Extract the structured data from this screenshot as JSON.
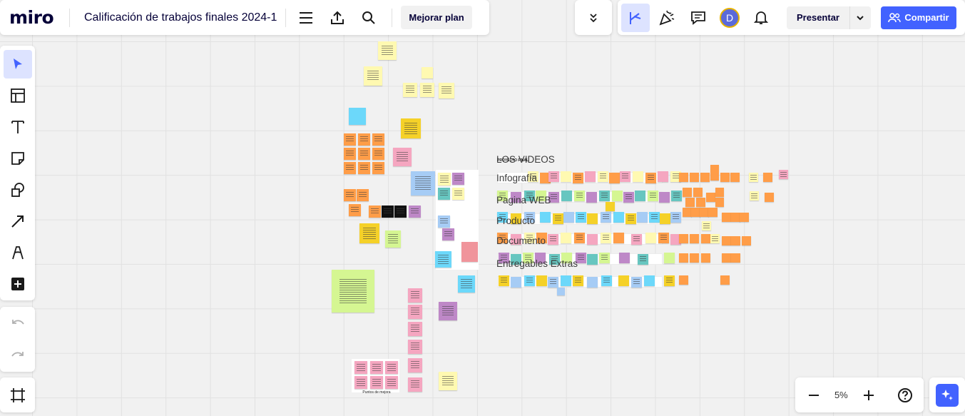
{
  "app": {
    "logo": "miro",
    "board_title": "Calificación de trabajos finales 2024-1"
  },
  "topbar": {
    "menu_icon": "menu-icon",
    "export_icon": "upload-icon",
    "search_icon": "search-icon",
    "upgrade_label": "Mejorar plan",
    "collapse_icon": "chevron-double-down-icon",
    "reactions_icon": "reactions-icon",
    "celebrate_icon": "party-popper-icon",
    "comments_icon": "comment-icon",
    "avatar_initial": "D",
    "notifications_icon": "bell-icon",
    "present_label": "Presentar",
    "share_label": "Compartir"
  },
  "toolbar": {
    "tools": [
      "select-tool",
      "templates-tool",
      "text-tool",
      "sticky-note-tool",
      "shapes-tool",
      "connector-tool",
      "pen-tool",
      "more-tools"
    ],
    "active_tool": "select-tool"
  },
  "zoom": {
    "level": "5%"
  },
  "board": {
    "sections": [
      "LOS VIDEOS",
      "Infografía",
      "Pagina WEB",
      "Producto",
      "Documento",
      "Entregables Extras"
    ],
    "header_small": "PROYECTO FINAL",
    "notes": [
      "Lectura fácil de entender",
      "Avances",
      "Elementos de diseño",
      "Ideas de mejora"
    ],
    "frame_caption": "Puntos de mejora"
  },
  "colors": {
    "accent": "#4262ff",
    "yellow": "#fff9b1",
    "orange": "#ff9d48",
    "pink": "#f5a6c0",
    "blue": "#6cd8fa",
    "purple": "#be88c7",
    "green": "#d5f692"
  }
}
